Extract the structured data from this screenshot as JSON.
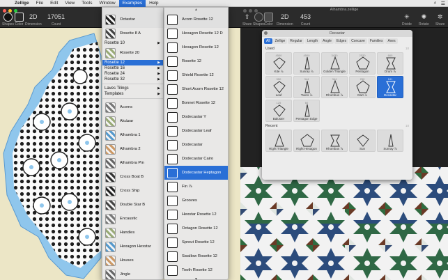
{
  "menubar": {
    "apple": "",
    "items": [
      "Zellige",
      "File",
      "Edit",
      "View",
      "Tools",
      "Window",
      "Examples",
      "Help"
    ],
    "active": "Examples"
  },
  "left_window": {
    "toolbar": [
      {
        "label": "Shapes",
        "kind": "swatch-black"
      },
      {
        "label": "Color",
        "kind": "swatch-dark"
      },
      {
        "label": "Dimension",
        "value": "2D"
      },
      {
        "label": "Count",
        "value": "17051"
      }
    ],
    "colors": {
      "background": "#ece6c6",
      "tile_blue": "#8fc6ec",
      "tile_dark": "#1e1e1e"
    }
  },
  "right_window": {
    "doc_title": "Alhambra.zellige",
    "toolbar": [
      {
        "label": "Share",
        "kind": "share"
      },
      {
        "label": "Shapes",
        "kind": "swatch"
      },
      {
        "label": "Color",
        "kind": "swatch"
      },
      {
        "label": "Dimension",
        "value": "2D"
      },
      {
        "label": "Count",
        "value": "453"
      }
    ],
    "toolbar_right": [
      "Divide",
      "Rotate",
      "Share"
    ],
    "colors": {
      "green": "#2f6b3f",
      "blue": "#2c4c7c",
      "brown": "#6a3a26",
      "white": "#f2f2f2"
    }
  },
  "palette": {
    "title": "Decastar",
    "tabs": [
      "All",
      "Zellige",
      "Regular",
      "Length",
      "Angle",
      "Edges",
      "Concave",
      "Families",
      "Axes"
    ],
    "active_tab": "All",
    "used": {
      "heading": "Used",
      "count": "10",
      "items": [
        {
          "n": "4500",
          "name": "Kite ⅞"
        },
        {
          "n": "4500",
          "name": "Sunray ⅞"
        },
        {
          "n": "3430",
          "name": "Golden Triangle"
        },
        {
          "n": "2520",
          "name": "Pentagon"
        },
        {
          "n": "660",
          "name": "Drum ⅞"
        },
        {
          "n": "550",
          "name": "Leaf"
        },
        {
          "n": "344",
          "name": "Twins ⅞"
        },
        {
          "n": "344",
          "name": "Rhombus ⅞"
        },
        {
          "n": "250",
          "name": "Dart ⅞"
        },
        {
          "n": "181",
          "name": "Decastar"
        },
        {
          "n": "125",
          "name": "Baluster"
        },
        {
          "n": "60",
          "name": "Pentagon Edge"
        }
      ],
      "selected": "Decastar"
    },
    "recent": {
      "heading": "Recent",
      "count": "10",
      "items": [
        {
          "name": "Right Triangle"
        },
        {
          "name": "Right Hexagon"
        },
        {
          "name": "Rhombus ⅞"
        },
        {
          "name": "Sun"
        },
        {
          "name": "Sunray ⅞"
        }
      ]
    }
  },
  "menu1": {
    "items": [
      {
        "label": "Octastar",
        "type": "thumb"
      },
      {
        "label": "Rosette 8 A",
        "type": "thumb"
      },
      {
        "label": "Rosette 10",
        "type": "submenu"
      },
      {
        "label": "Rosette 20",
        "type": "thumb"
      },
      {
        "label": "Rosette 12",
        "type": "submenu",
        "highlighted": true
      },
      {
        "label": "Rosette 16",
        "type": "submenu"
      },
      {
        "label": "Rosette 24",
        "type": "submenu"
      },
      {
        "label": "Rosette 32",
        "type": "submenu"
      },
      {
        "label": "Laves Tilings",
        "type": "submenu"
      },
      {
        "label": "Templates",
        "type": "submenu"
      },
      {
        "label": "Acorns",
        "type": "thumb"
      },
      {
        "label": "Alcázar",
        "type": "thumb"
      },
      {
        "label": "Alhambra 1",
        "type": "thumb"
      },
      {
        "label": "Alhambra 2",
        "type": "thumb"
      },
      {
        "label": "Alhambra Pin",
        "type": "thumb"
      },
      {
        "label": "Cross Boat B",
        "type": "thumb"
      },
      {
        "label": "Cross Ship",
        "type": "thumb"
      },
      {
        "label": "Double Star B",
        "type": "thumb"
      },
      {
        "label": "Encaustic",
        "type": "thumb"
      },
      {
        "label": "Handles",
        "type": "thumb"
      },
      {
        "label": "Hexagon Hexstar",
        "type": "thumb"
      },
      {
        "label": "Houses",
        "type": "thumb"
      },
      {
        "label": "Jingle",
        "type": "thumb"
      }
    ]
  },
  "menu2": {
    "items": [
      {
        "label": "Acorn Rosette 12"
      },
      {
        "label": "Hexagon Rosette 12 D"
      },
      {
        "label": "Hexagon Rosette 12"
      },
      {
        "label": "Rosette 12"
      },
      {
        "label": "Shield Rosette 12"
      },
      {
        "label": "Short Acorn Rosette 12"
      },
      {
        "label": "Bonnet Rosette 12"
      },
      {
        "label": "Dodecastar Y"
      },
      {
        "label": "Dodecastar Leaf"
      },
      {
        "label": "Dodecastar"
      },
      {
        "label": "Dodecastar Cairo"
      },
      {
        "label": "Dodecastar Heptagon",
        "highlighted": true
      },
      {
        "label": "Fin ⅞"
      },
      {
        "label": "Grooves"
      },
      {
        "label": "Hexstar Rosette 12"
      },
      {
        "label": "Octagon Rosette 12"
      },
      {
        "label": "Sprout Rosette 12"
      },
      {
        "label": "Swallow Rosette 12"
      },
      {
        "label": "Tooth Rosette 12"
      }
    ]
  }
}
